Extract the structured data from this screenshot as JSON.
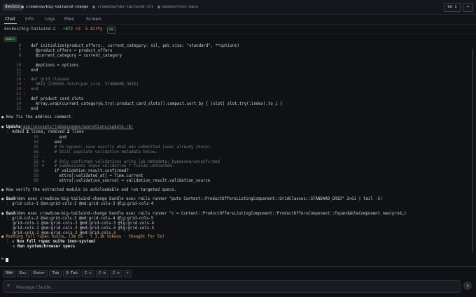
{
  "topbar": {
    "brand": "devbox",
    "windows": [
      {
        "label": "crowdcow/big-tailwind-change",
        "active": true
      },
      {
        "label": "crowdcow/cms-tailwind-ilt",
        "active": false
      },
      {
        "label": "devbox/test-main",
        "active": false
      }
    ],
    "bd_label": "bd 1",
    "plus_label": "+"
  },
  "tabs": [
    "Chat",
    "Info",
    "Logs",
    "Files",
    "Screen"
  ],
  "status": {
    "repo": "devbox/big-tailwind-2",
    "added": "+872",
    "removed": "+2",
    "dirty": "5 dirty",
    "pr": "PR"
  },
  "branch": "main",
  "code_block_1": [
    {
      "num": "6",
      "mark": "",
      "text": "def initialize(product_offers:, current_category: nil, pdc_size: \"standard\", **options)",
      "dim": false
    },
    {
      "num": "7",
      "mark": "",
      "text": "  @product_offers = product_offers",
      "dim": false
    },
    {
      "num": "8",
      "mark": "",
      "text": "  @current_category = current_category",
      "dim": false
    },
    {
      "num": "...",
      "mark": "",
      "text": "",
      "dim": false
    },
    {
      "num": "10",
      "mark": "",
      "text": "  @options = options",
      "dim": false
    },
    {
      "num": "11",
      "mark": "",
      "text": "end",
      "dim": false
    },
    {
      "num": "12",
      "mark": "",
      "text": "",
      "dim": false
    },
    {
      "num": "18",
      "mark": "-",
      "text": "def grid_classes",
      "dim": true
    },
    {
      "num": "19",
      "mark": "-",
      "text": "  GRID_CLASSES.fetch(pdc_size, STANDARD_GRID)",
      "dim": true
    },
    {
      "num": "20",
      "mark": "-",
      "text": "end",
      "dim": true
    },
    {
      "num": "21",
      "mark": "-",
      "text": "",
      "dim": true
    },
    {
      "num": "13",
      "mark": "",
      "text": "def product_card_slots",
      "dim": false
    },
    {
      "num": "14",
      "mark": "",
      "text": "  Array.wrap(current_category&.try(:product_card_slots)).compact.sort_by { |slot| slot.try(:index).to_i }",
      "dim": false
    },
    {
      "num": "15",
      "mark": "",
      "text": "end",
      "dim": false
    }
  ],
  "msg_fix": "Now fix the address comment.",
  "update": {
    "label": "Update",
    "path": "(app/concepts/jobbessages/operations/update.rb)",
    "summary_prefix": "Added ",
    "added_n": "2",
    "summary_mid": " lines, removed ",
    "removed_n": "2",
    "summary_suffix": " lines"
  },
  "code_block_2": [
    {
      "num": "53",
      "mark": "",
      "text": "      end",
      "dim": false
    },
    {
      "num": "54",
      "mark": "",
      "text": "    end",
      "dim": false
    },
    {
      "num": "55",
      "mark": "",
      "text": "    # On bypass: save exactly what was submitted (user already chose).",
      "dim": true
    },
    {
      "num": "56",
      "mark": "-",
      "text": "    # Still populate validation metadata below.",
      "dim": true
    },
    {
      "num": "57",
      "mark": "-",
      "text": "",
      "dim": true
    },
    {
      "num": "56",
      "mark": "+",
      "text": "    # Only confirmed validations write lob metadata; bypassed/unconfirmed",
      "dim": true
    },
    {
      "num": "57",
      "mark": "+",
      "text": "    # submissions leave validation_* fields untouched.",
      "dim": true
    },
    {
      "num": "58",
      "mark": "",
      "text": "    if validation_result.confirmed?",
      "dim": false
    },
    {
      "num": "59",
      "mark": "",
      "text": "      attrs[:validated_at] = Time.current",
      "dim": false
    },
    {
      "num": "60",
      "mark": "",
      "text": "      attrs[:validation_source] = validation_result.validation_source",
      "dim": false
    }
  ],
  "msg_verify": "Now verify the extracted module is autoloadable and run targeted specs.",
  "bash1": {
    "label": "Bash",
    "cmd": "(dev exec crowdcow-big-tailwind-change bundle exec rails runner \"puts Content::ProductOffersListingComponent::GridClasses::STANDARD_GRID\" 2>&1 | tail -5)",
    "out": "grid-cols-1 @sm:grid-cols-2 @md:grid-cols-3 @lg:grid-cols-4"
  },
  "bash2": {
    "label": "Bash",
    "cmd": "(dev exec crowdcow-big-tailwind-change bundle exec rails runner \"c = Content::ProductOffersListingComponent::ProductOffersComponent::ExpandableComponent.new(prod…)",
    "out": [
      "grid-cols-2 @sm:grid-cols-3 @md:grid-cols-4 @lg:grid-cols-5",
      "grid-cols-1 @sm:grid-cols-2 @md:grid-cols-3 @lg:grid-cols-4",
      "grid-cols-2 @sm:grid-cols-3 @md:grid-cols-4 @lg:grid-cols-5",
      "grid-cols-2 @sm:grid-cols-2 @md:grid-cols-3"
    ]
  },
  "running": {
    "text": "Running full rspec suite… (3m 6s · ↑ 3.1k tokens · thought for 5s)",
    "items": [
      "Run full rspec suite (non-system)",
      "Run system/browser specs"
    ]
  },
  "prompt": ">",
  "keys": [
    "RAW",
    "Esc",
    "Enter",
    "Tab",
    "S-Tab",
    "C-c",
    "C-b",
    "C-n",
    "+"
  ],
  "composer": {
    "placeholder": "Message Claude..."
  },
  "colors": {
    "accent": "#8fb9ff",
    "green": "#7ed07e",
    "orange": "#e0a85a",
    "red": "#e08a8a"
  }
}
